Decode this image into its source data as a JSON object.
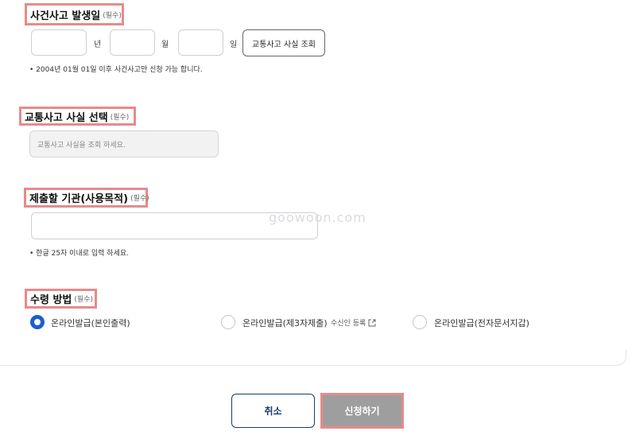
{
  "accident_date": {
    "title": "사건사고 발생일",
    "required": "(필수)",
    "year_unit": "년",
    "month_unit": "월",
    "day_unit": "일",
    "lookup_button": "교통사고 사실 조회",
    "note": "• 2004년 01월 01일 이후 사건사고만 신청 가능 합니다."
  },
  "accident_select": {
    "title": "교통사고 사실 선택",
    "required": "(필수)",
    "placeholder": "교통사고 사실을 조회 하세요."
  },
  "institution": {
    "title": "제출할 기관(사용목적)",
    "required": "(필수)",
    "value": "",
    "note": "• 한글 25자 이내로 입력 하세요."
  },
  "receive_method": {
    "title": "수령 방법",
    "required": "(필수)",
    "options": [
      {
        "label": "온라인발급(본인출력)",
        "selected": true
      },
      {
        "label": "온라인발급(제3자제출)",
        "selected": false,
        "sub_link": "수신인 등록"
      },
      {
        "label": "온라인발급(전자문서지갑)",
        "selected": false
      }
    ]
  },
  "watermark": "goowoon.com",
  "footer": {
    "cancel": "취소",
    "submit": "신청하기"
  }
}
